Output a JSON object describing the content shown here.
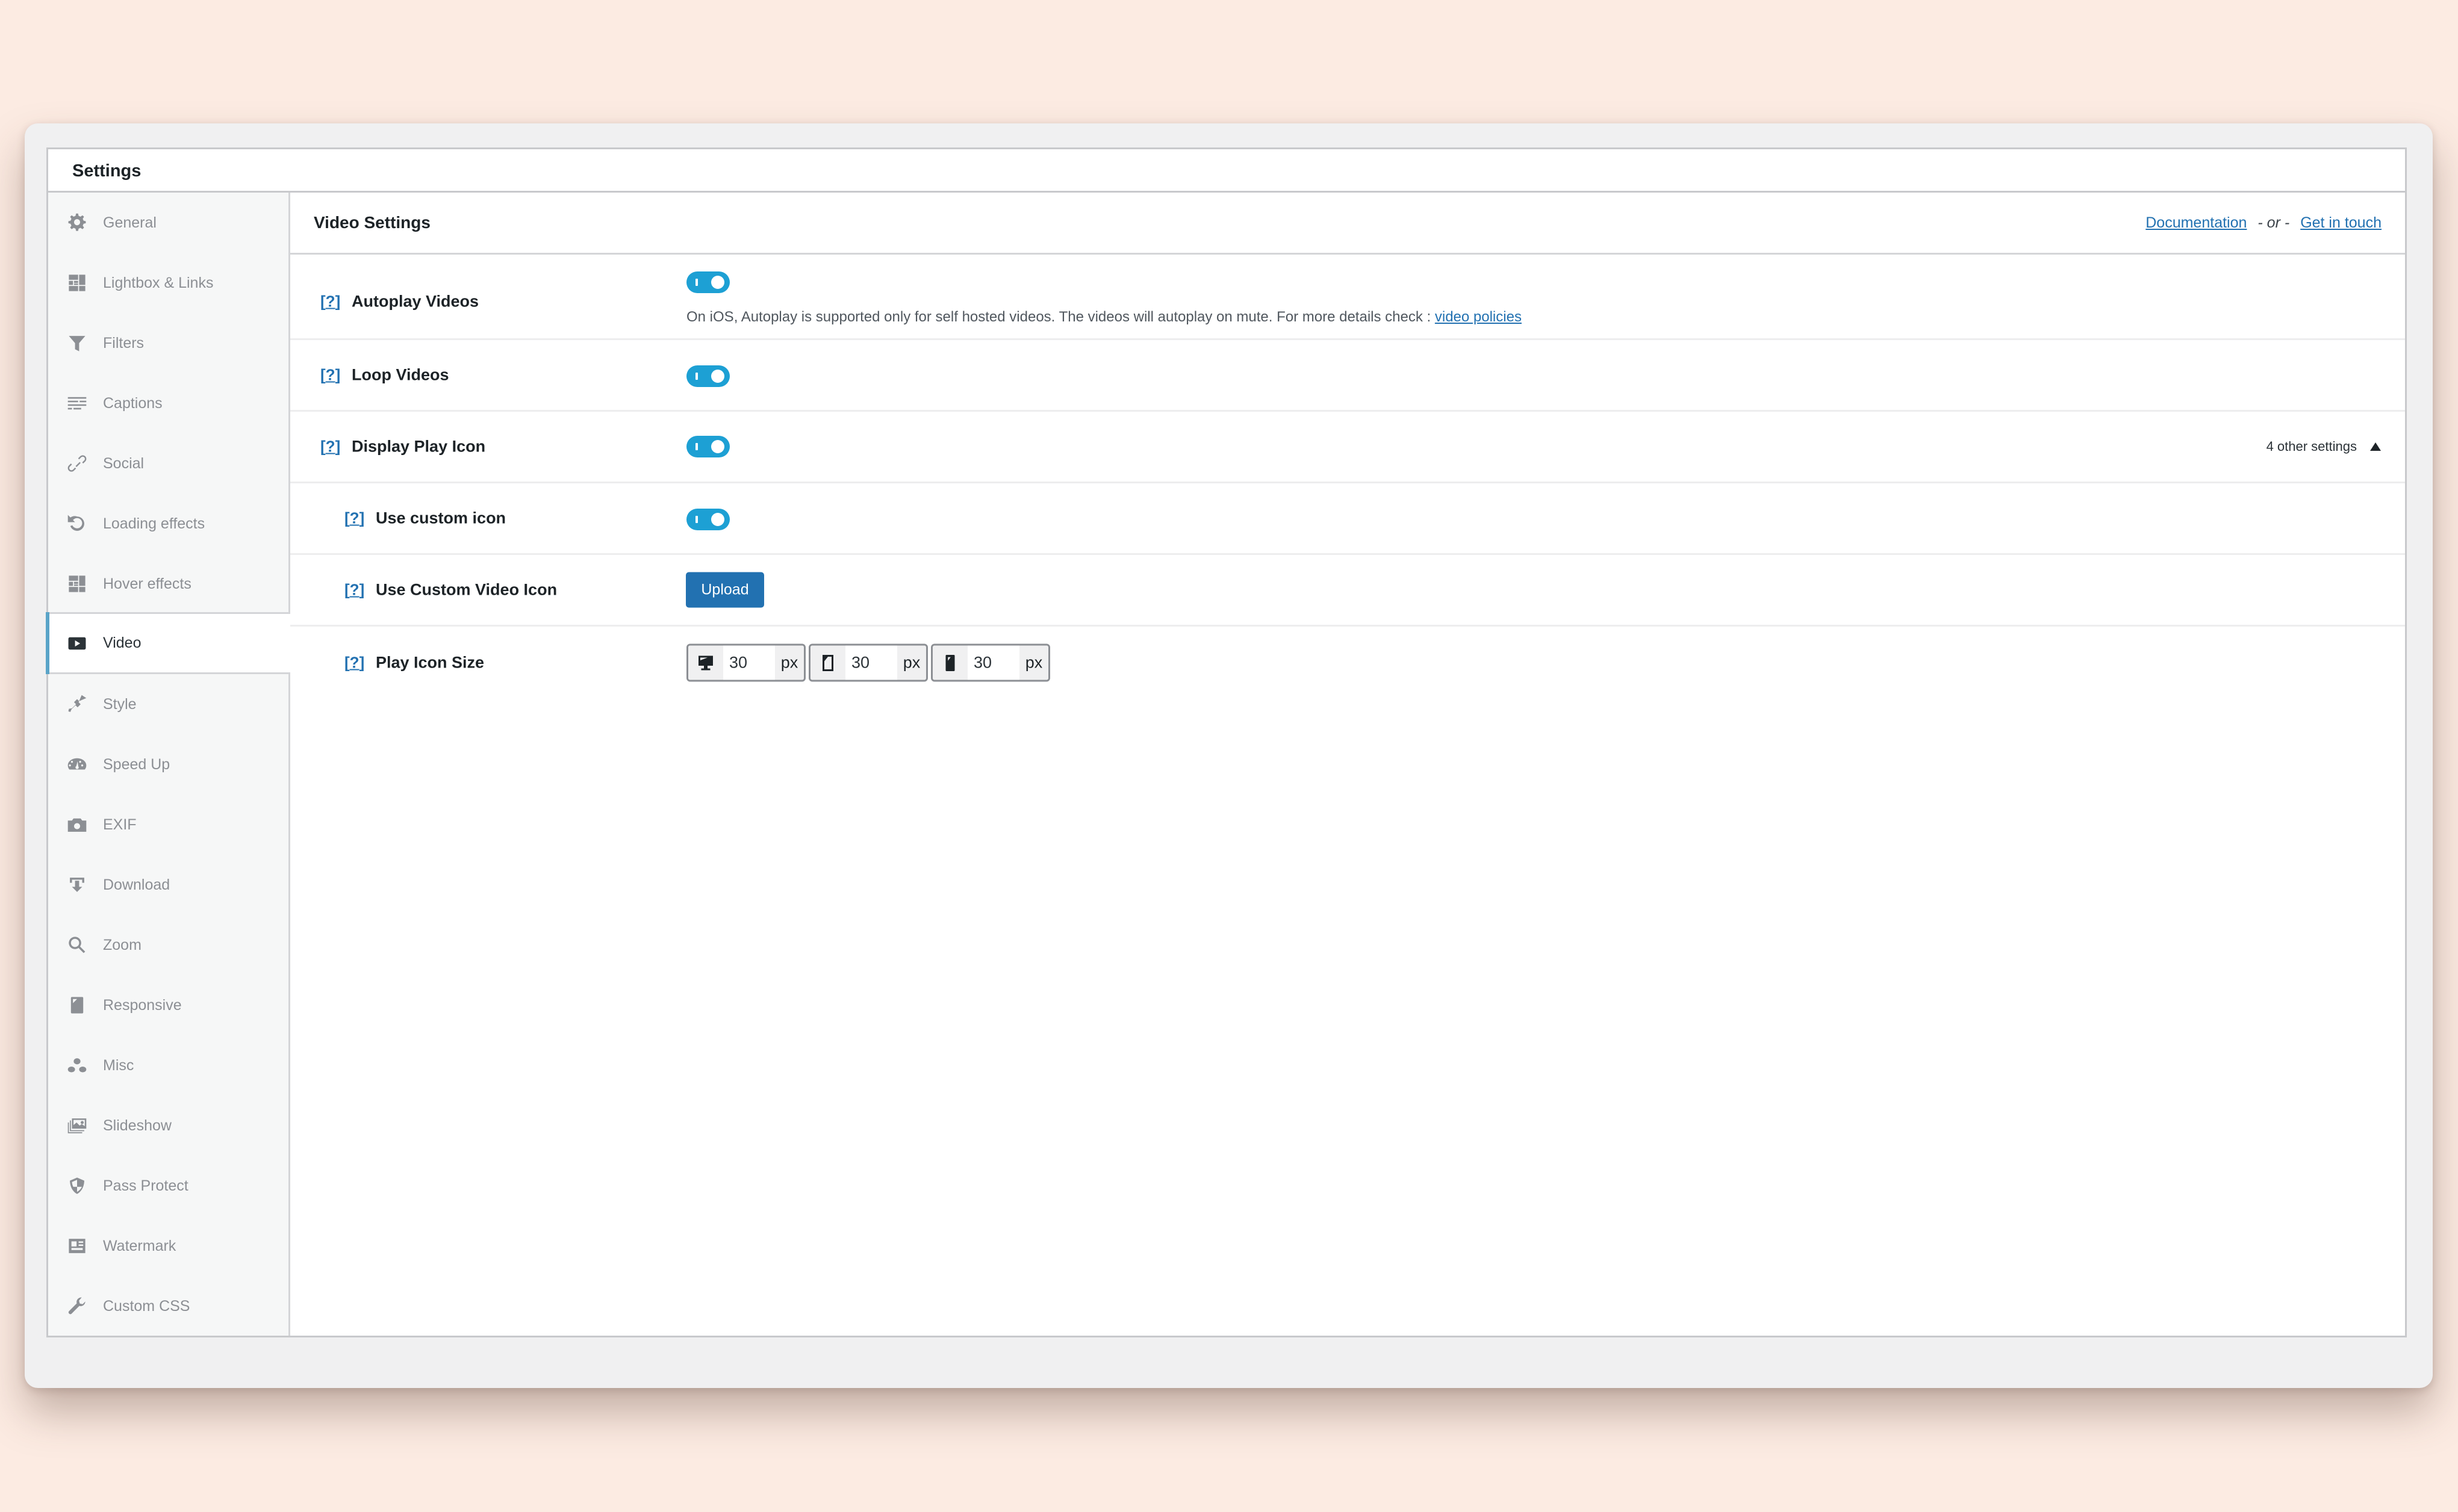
{
  "panel": {
    "title": "Settings"
  },
  "sidebar": {
    "items": [
      {
        "label": "General",
        "icon": "gear-icon"
      },
      {
        "label": "Lightbox & Links",
        "icon": "grid-layout-icon"
      },
      {
        "label": "Filters",
        "icon": "filter-icon"
      },
      {
        "label": "Captions",
        "icon": "captions-icon"
      },
      {
        "label": "Social",
        "icon": "link-icon"
      },
      {
        "label": "Loading effects",
        "icon": "undo-icon"
      },
      {
        "label": "Hover effects",
        "icon": "grid-layout-icon"
      },
      {
        "label": "Video",
        "icon": "video-play-icon",
        "active": true
      },
      {
        "label": "Style",
        "icon": "paintbrush-icon"
      },
      {
        "label": "Speed Up",
        "icon": "dashboard-icon"
      },
      {
        "label": "EXIF",
        "icon": "camera-icon"
      },
      {
        "label": "Download",
        "icon": "download-icon"
      },
      {
        "label": "Zoom",
        "icon": "search-icon"
      },
      {
        "label": "Responsive",
        "icon": "tablet-icon"
      },
      {
        "label": "Misc",
        "icon": "groups-icon"
      },
      {
        "label": "Slideshow",
        "icon": "images-icon"
      },
      {
        "label": "Pass Protect",
        "icon": "shield-icon"
      },
      {
        "label": "Watermark",
        "icon": "id-card-icon"
      },
      {
        "label": "Custom CSS",
        "icon": "wrench-icon"
      }
    ]
  },
  "main": {
    "title": "Video Settings",
    "links": {
      "documentation": "Documentation",
      "separator": "- or -",
      "contact": "Get in touch"
    },
    "help_marker": "?",
    "settings": {
      "autoplay": {
        "label": "Autoplay Videos",
        "enabled": true,
        "description": "On iOS, Autoplay is supported only for self hosted videos. The videos will autoplay on mute. For more details check : ",
        "description_link": "video policies"
      },
      "loop": {
        "label": "Loop Videos",
        "enabled": true
      },
      "display_play_icon": {
        "label": "Display Play Icon",
        "enabled": true,
        "more_settings": "4 other settings",
        "expanded": true
      },
      "use_custom_icon": {
        "label": "Use custom icon",
        "enabled": true
      },
      "custom_video_icon": {
        "label": "Use Custom Video Icon",
        "button": "Upload"
      },
      "play_icon_size": {
        "label": "Play Icon Size",
        "desktop": {
          "value": "30",
          "unit": "px",
          "icon": "desktop-icon"
        },
        "tablet": {
          "value": "30",
          "unit": "px",
          "icon": "tablet-icon"
        },
        "mobile": {
          "value": "30",
          "unit": "px",
          "icon": "smartphone-icon"
        }
      }
    }
  },
  "colors": {
    "accent": "#2271b1",
    "toggle_on": "#1da0d4",
    "active_indicator": "#5aa4c8",
    "background": "#fcebe2"
  }
}
